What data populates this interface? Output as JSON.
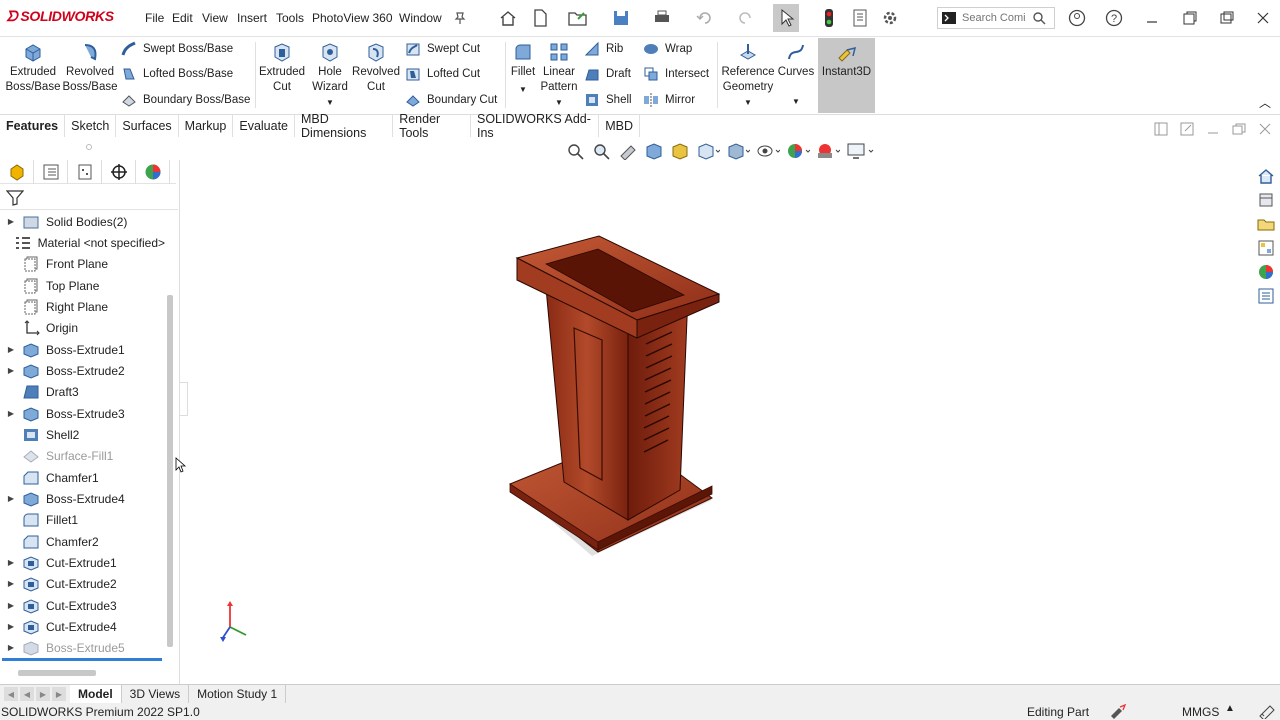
{
  "app": {
    "logo_text": "SOLIDWORKS"
  },
  "menu": [
    "File",
    "Edit",
    "View",
    "Insert",
    "Tools",
    "PhotoView 360",
    "Window"
  ],
  "search": {
    "placeholder": "Search Comi"
  },
  "ribbon": {
    "extruded_boss": "Extruded Boss/Base",
    "revolved_boss": "Revolved Boss/Base",
    "swept_boss": "Swept Boss/Base",
    "lofted_boss": "Lofted Boss/Base",
    "boundary_boss": "Boundary Boss/Base",
    "extruded_cut": "Extruded Cut",
    "hole_wizard": "Hole Wizard",
    "revolved_cut": "Revolved Cut",
    "swept_cut": "Swept Cut",
    "lofted_cut": "Lofted Cut",
    "boundary_cut": "Boundary Cut",
    "fillet": "Fillet",
    "linear_pattern": "Linear Pattern",
    "rib": "Rib",
    "draft": "Draft",
    "shell": "Shell",
    "wrap": "Wrap",
    "intersect": "Intersect",
    "mirror": "Mirror",
    "reference_geometry": "Reference Geometry",
    "curves": "Curves",
    "instant3d": "Instant3D"
  },
  "tabs": [
    "Features",
    "Sketch",
    "Surfaces",
    "Markup",
    "Evaluate",
    "MBD Dimensions",
    "Render Tools",
    "SOLIDWORKS Add-Ins",
    "MBD"
  ],
  "tree": [
    {
      "label": "Solid Bodies(2)",
      "expand": true,
      "icon": "folder-icon",
      "dim": false
    },
    {
      "label": "Material <not specified>",
      "expand": false,
      "icon": "material-icon",
      "dim": false
    },
    {
      "label": "Front Plane",
      "expand": false,
      "icon": "plane-icon",
      "dim": false
    },
    {
      "label": "Top Plane",
      "expand": false,
      "icon": "plane-icon",
      "dim": false
    },
    {
      "label": "Right Plane",
      "expand": false,
      "icon": "plane-icon",
      "dim": false
    },
    {
      "label": "Origin",
      "expand": false,
      "icon": "origin-icon",
      "dim": false
    },
    {
      "label": "Boss-Extrude1",
      "expand": true,
      "icon": "boss-icon",
      "dim": false
    },
    {
      "label": "Boss-Extrude2",
      "expand": true,
      "icon": "boss-icon",
      "dim": false
    },
    {
      "label": "Draft3",
      "expand": false,
      "icon": "draft-icon",
      "dim": false
    },
    {
      "label": "Boss-Extrude3",
      "expand": true,
      "icon": "boss-icon",
      "dim": false
    },
    {
      "label": "Shell2",
      "expand": false,
      "icon": "shell-icon",
      "dim": false
    },
    {
      "label": "Surface-Fill1",
      "expand": false,
      "icon": "surface-icon",
      "dim": true
    },
    {
      "label": "Chamfer1",
      "expand": false,
      "icon": "chamfer-icon",
      "dim": false
    },
    {
      "label": "Boss-Extrude4",
      "expand": true,
      "icon": "boss-icon",
      "dim": false
    },
    {
      "label": "Fillet1",
      "expand": false,
      "icon": "fillet-icon",
      "dim": false
    },
    {
      "label": "Chamfer2",
      "expand": false,
      "icon": "chamfer-icon",
      "dim": false
    },
    {
      "label": "Cut-Extrude1",
      "expand": true,
      "icon": "cut-icon",
      "dim": false
    },
    {
      "label": "Cut-Extrude2",
      "expand": true,
      "icon": "cut-icon",
      "dim": false
    },
    {
      "label": "Cut-Extrude3",
      "expand": true,
      "icon": "cut-icon",
      "dim": false
    },
    {
      "label": "Cut-Extrude4",
      "expand": true,
      "icon": "cut-icon",
      "dim": false
    },
    {
      "label": "Boss-Extrude5",
      "expand": true,
      "icon": "boss-icon",
      "dim": true
    }
  ],
  "bottom_tabs": [
    "Model",
    "3D Views",
    "Motion Study 1"
  ],
  "status": {
    "version": "SOLIDWORKS Premium 2022 SP1.0",
    "mode": "Editing Part",
    "units": "MMGS"
  }
}
